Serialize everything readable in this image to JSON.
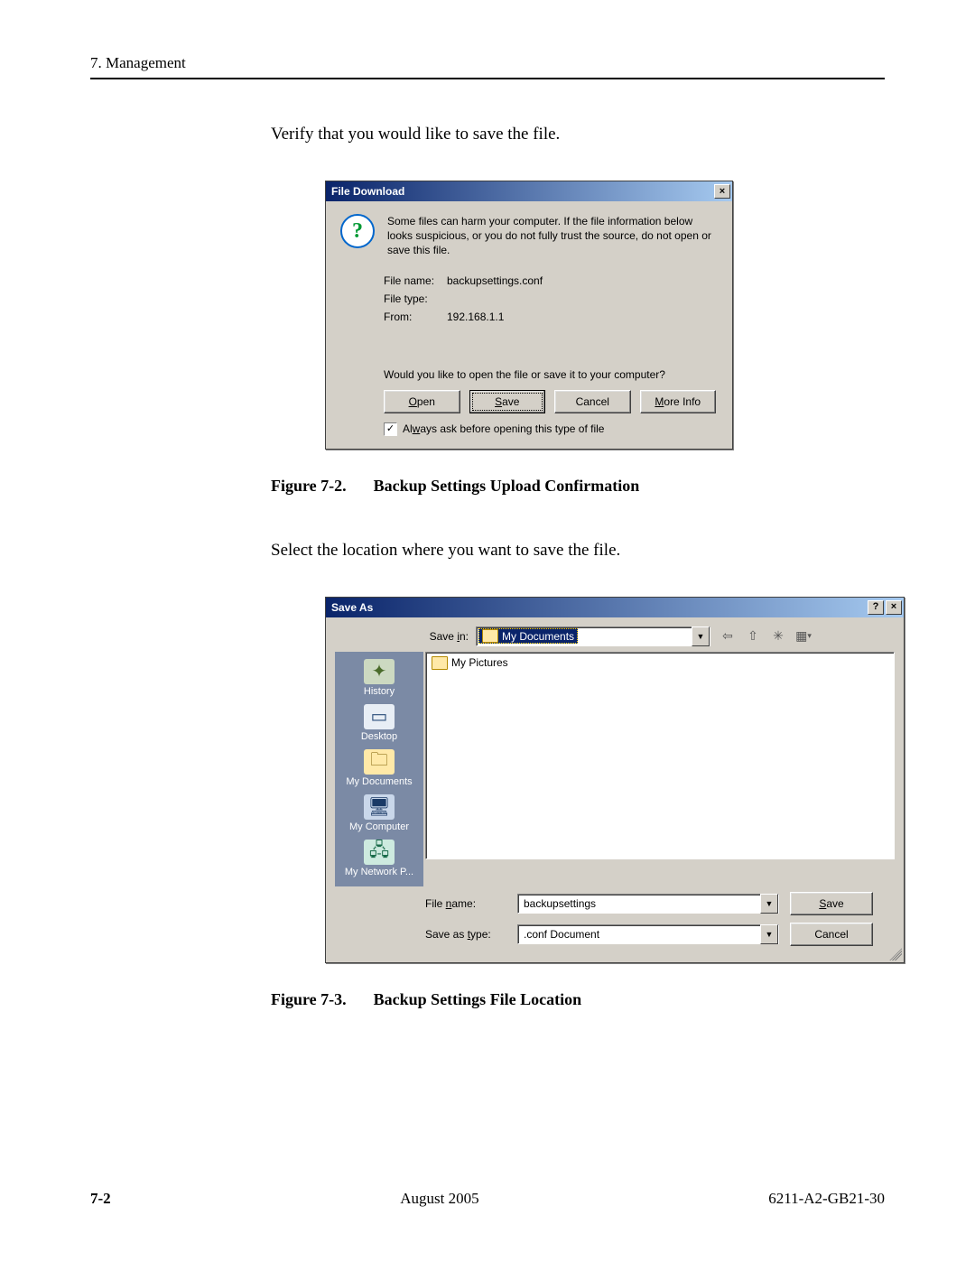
{
  "header": {
    "section": "7. Management"
  },
  "body": {
    "para1": "Verify that you would like to save the file.",
    "para2": "Select the location where you want to save the file."
  },
  "fig1": {
    "dialog_title": "File Download",
    "close_glyph": "×",
    "question_icon": "?",
    "warning": "Some files can harm your computer. If the file information below looks suspicious, or you do not fully trust the source, do not open or save this file.",
    "filename_label": "File name:",
    "filename_value": "backupsettings.conf",
    "filetype_label": "File type:",
    "filetype_value": "",
    "from_label": "From:",
    "from_value": "192.168.1.1",
    "prompt": "Would you like to open the file or save it to your computer?",
    "open_pre": "O",
    "open_rest": "pen",
    "save_pre": "S",
    "save_rest": "ave",
    "cancel": "Cancel",
    "moreinfo_pre": "M",
    "moreinfo_rest": "ore Info",
    "always_pre": "Al",
    "always_u": "w",
    "always_rest": "ays ask before opening this type of file",
    "check_glyph": "✓",
    "caption_num": "Figure 7-2.",
    "caption_text": "Backup Settings Upload Confirmation"
  },
  "fig2": {
    "dialog_title": "Save As",
    "help_glyph": "?",
    "close_glyph": "×",
    "savein_pre": "Save ",
    "savein_u": "i",
    "savein_rest": "n:",
    "savein_value": "My Documents",
    "tb_back": "⇦",
    "tb_up": "⇧",
    "tb_new": "✳",
    "tb_view": "▦",
    "tb_view_dd": "▾",
    "places": {
      "history": "History",
      "desktop": "Desktop",
      "mydocs": "My Documents",
      "mycomp": "My Computer",
      "netp": "My Network P..."
    },
    "file_item": "My Pictures",
    "filename_pre": "File ",
    "filename_u": "n",
    "filename_rest": "ame:",
    "filename_value": "backupsettings",
    "saveas_pre": "Save as ",
    "saveas_u": "t",
    "saveas_rest": "ype:",
    "saveas_value": ".conf Document",
    "save_btn_pre": "S",
    "save_btn_rest": "ave",
    "cancel_btn": "Cancel",
    "caption_num": "Figure 7-3.",
    "caption_text": "Backup Settings File Location"
  },
  "footer": {
    "page": "7-2",
    "date": "August 2005",
    "docid": "6211-A2-GB21-30"
  }
}
